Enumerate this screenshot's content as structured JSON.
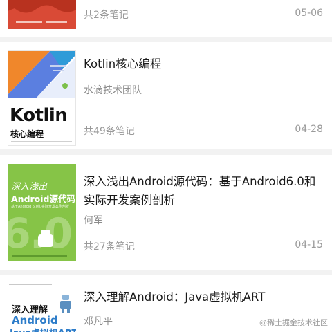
{
  "books": [
    {
      "title": "",
      "author": "",
      "count": "共2条笔记",
      "date": "05-06",
      "cover_color": "#d94a36"
    },
    {
      "title": "Kotlin核心编程",
      "author": "水滴技术团队",
      "count": "共49条笔记",
      "date": "04-28",
      "cover": {
        "brand": "Kotlin",
        "subtitle": "核心编程"
      }
    },
    {
      "title": "深入浅出Android源代码：基于Android6.0和实际开发案例剖析",
      "author": "何军",
      "count": "共27条笔记",
      "date": "04-15",
      "cover": {
        "script": "深入浅出",
        "main": "Android源代码",
        "sub": "基于Android 6.0和实际开发案例剖析",
        "version": "6.0",
        "color": "#86c447"
      }
    },
    {
      "title": "深入理解Android：Java虚拟机ART",
      "author": "邓凡平",
      "cover": {
        "line1": "深入理解",
        "line2": "Android",
        "line3": "Java虚拟机ART"
      }
    }
  ],
  "watermark": "@稀土掘金技术社区"
}
